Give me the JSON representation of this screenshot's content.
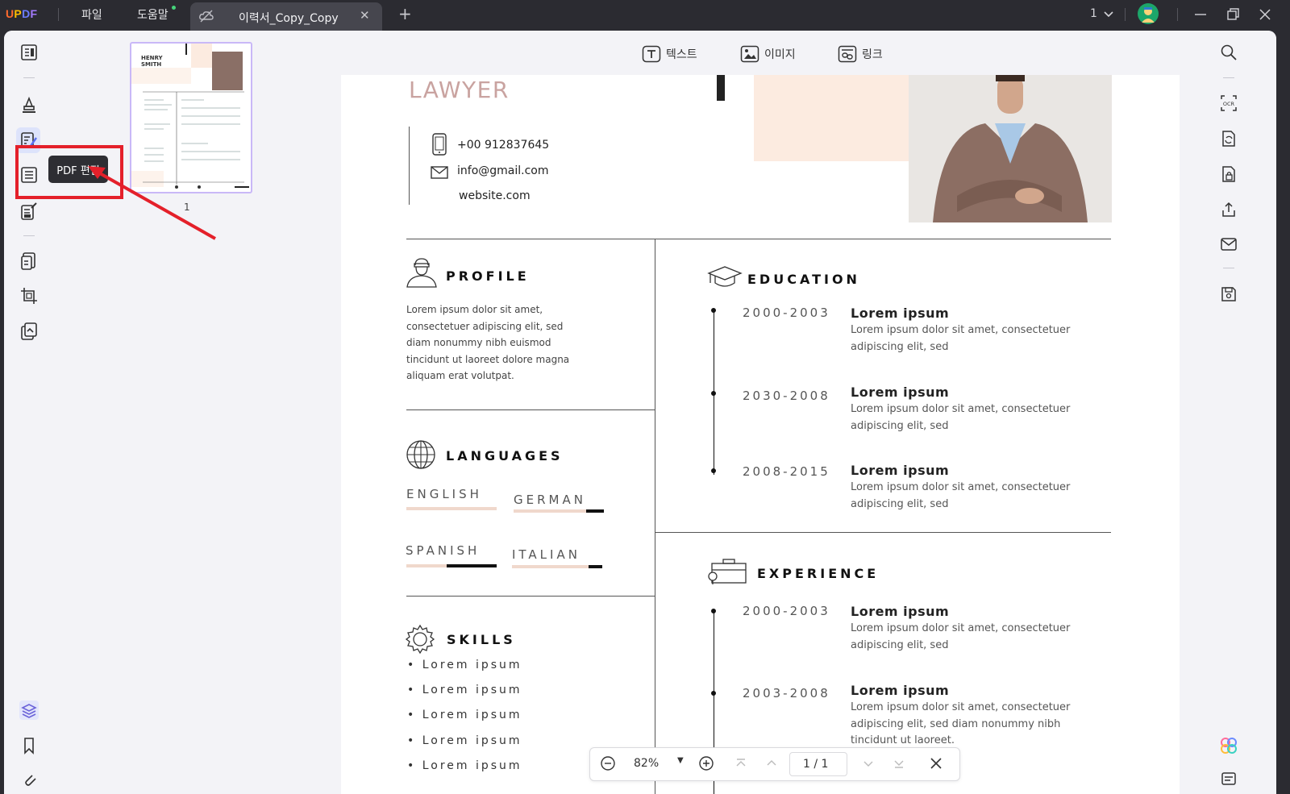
{
  "app": {
    "logo": "UPDF",
    "menu": [
      "파일",
      "도움말"
    ],
    "tab_title": "이력서_Copy_Copy",
    "page_indicator": "1"
  },
  "toolbar": {
    "text": "텍스트",
    "image": "이미지",
    "link": "링크"
  },
  "tooltip": "PDF 편집",
  "thumbnail": {
    "page_number": "1",
    "name_line1": "HENRY",
    "name_line2": "SMITH"
  },
  "zoom": {
    "level": "82%",
    "page": "1 / 1"
  },
  "resume": {
    "title": "LAWYER",
    "phone": "+00 912837645",
    "email": "info@gmail.com",
    "website": "website.com",
    "profile": {
      "heading": "PROFILE",
      "text": "Lorem ipsum dolor sit amet, consectetuer adipiscing elit, sed diam nonummy nibh euismod tincidunt ut laoreet dolore magna aliquam erat volutpat."
    },
    "languages": {
      "heading": "LANGUAGES",
      "items": [
        {
          "name": "ENGLISH",
          "level": 0.0
        },
        {
          "name": "GERMAN",
          "level": 0.2
        },
        {
          "name": "SPANISH",
          "level": 0.55
        },
        {
          "name": "ITALIAN",
          "level": 0.15
        }
      ]
    },
    "skills": {
      "heading": "SKILLS",
      "items": [
        "Lorem ipsum",
        "Lorem ipsum",
        "Lorem ipsum",
        "Lorem ipsum",
        "Lorem ipsum"
      ]
    },
    "education": {
      "heading": "EDUCATION",
      "items": [
        {
          "years": "2000-2003",
          "title": "Lorem ipsum",
          "desc": "Lorem ipsum dolor sit amet, consectetuer adipiscing elit, sed"
        },
        {
          "years": "2030-2008",
          "title": "Lorem ipsum",
          "desc": "Lorem ipsum dolor sit amet, consectetuer adipiscing elit, sed"
        },
        {
          "years": "2008-2015",
          "title": "Lorem ipsum",
          "desc": "Lorem ipsum dolor sit amet, consectetuer adipiscing elit, sed"
        }
      ]
    },
    "experience": {
      "heading": "EXPERIENCE",
      "items": [
        {
          "years": "2000-2003",
          "title": "Lorem ipsum",
          "desc": "Lorem ipsum dolor sit amet, consectetuer adipiscing elit, sed"
        },
        {
          "years": "2003-2008",
          "title": "Lorem ipsum",
          "desc": "Lorem ipsum dolor sit amet, consectetuer adipiscing elit, sed diam nonummy nibh tincidunt ut laoreet."
        }
      ]
    }
  },
  "colors": {
    "accent_lilac": "#c9b8f7",
    "annotation_red": "#e4202a",
    "title_rose": "#c9a3a0",
    "peach_block": "#fcebe0"
  }
}
